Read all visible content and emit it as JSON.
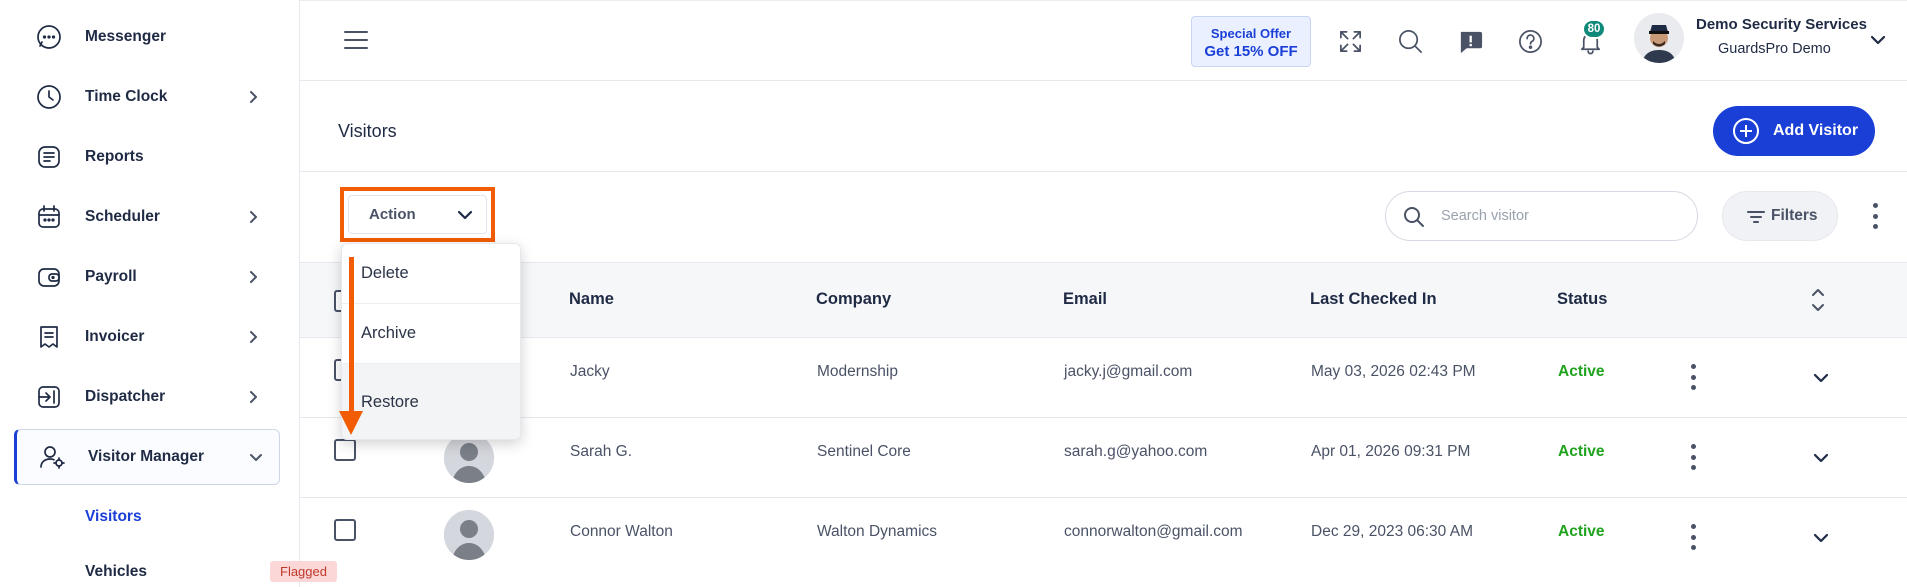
{
  "sidebar": {
    "items": [
      {
        "label": "Messenger",
        "icon": "chat-icon",
        "has_chevron": false
      },
      {
        "label": "Time Clock",
        "icon": "clock-icon",
        "has_chevron": true
      },
      {
        "label": "Reports",
        "icon": "report-icon",
        "has_chevron": false
      },
      {
        "label": "Scheduler",
        "icon": "calendar-icon",
        "has_chevron": true
      },
      {
        "label": "Payroll",
        "icon": "wallet-icon",
        "has_chevron": true
      },
      {
        "label": "Invoicer",
        "icon": "invoice-icon",
        "has_chevron": true
      },
      {
        "label": "Dispatcher",
        "icon": "dispatch-icon",
        "has_chevron": true
      },
      {
        "label": "Visitor Manager",
        "icon": "visitor-manager-icon",
        "has_chevron": true,
        "expanded": true
      }
    ],
    "sub_items": [
      {
        "label": "Visitors",
        "active": true
      },
      {
        "label": "Vehicles",
        "active": false
      }
    ]
  },
  "topbar": {
    "offer_line1": "Special Offer",
    "offer_line2": "Get 15% OFF",
    "notification_count": "80",
    "org_name": "Demo Security Services",
    "org_sub": "GuardsPro Demo"
  },
  "page": {
    "title": "Visitors",
    "add_button": "Add Visitor"
  },
  "toolbar": {
    "action_label": "Action",
    "search_placeholder": "Search visitor",
    "filters_label": "Filters"
  },
  "action_menu": {
    "items": [
      "Delete",
      "Archive",
      "Restore"
    ],
    "hovered": "Restore"
  },
  "table": {
    "columns": [
      "Name",
      "Company",
      "Email",
      "Last Checked In",
      "Status"
    ],
    "rows": [
      {
        "name": "Jacky",
        "company": "Modernship",
        "email": "jacky.j@gmail.com",
        "last_checked_in": "May 03, 2026 02:43 PM",
        "status": "Active"
      },
      {
        "name": "Sarah G.",
        "company": "Sentinel Core",
        "email": "sarah.g@yahoo.com",
        "last_checked_in": "Apr 01, 2026 09:31 PM",
        "status": "Active"
      },
      {
        "name": "Connor Walton",
        "company": "Walton Dynamics",
        "email": "connorwalton@gmail.com",
        "last_checked_in": "Dec 29, 2023 06:30 AM",
        "status": "Active",
        "tag": "Flagged"
      }
    ]
  },
  "colors": {
    "primary": "#1a3fd6",
    "highlight": "#f25c05",
    "status_active": "#1fa31f",
    "flag_bg": "#fbd7d7"
  }
}
